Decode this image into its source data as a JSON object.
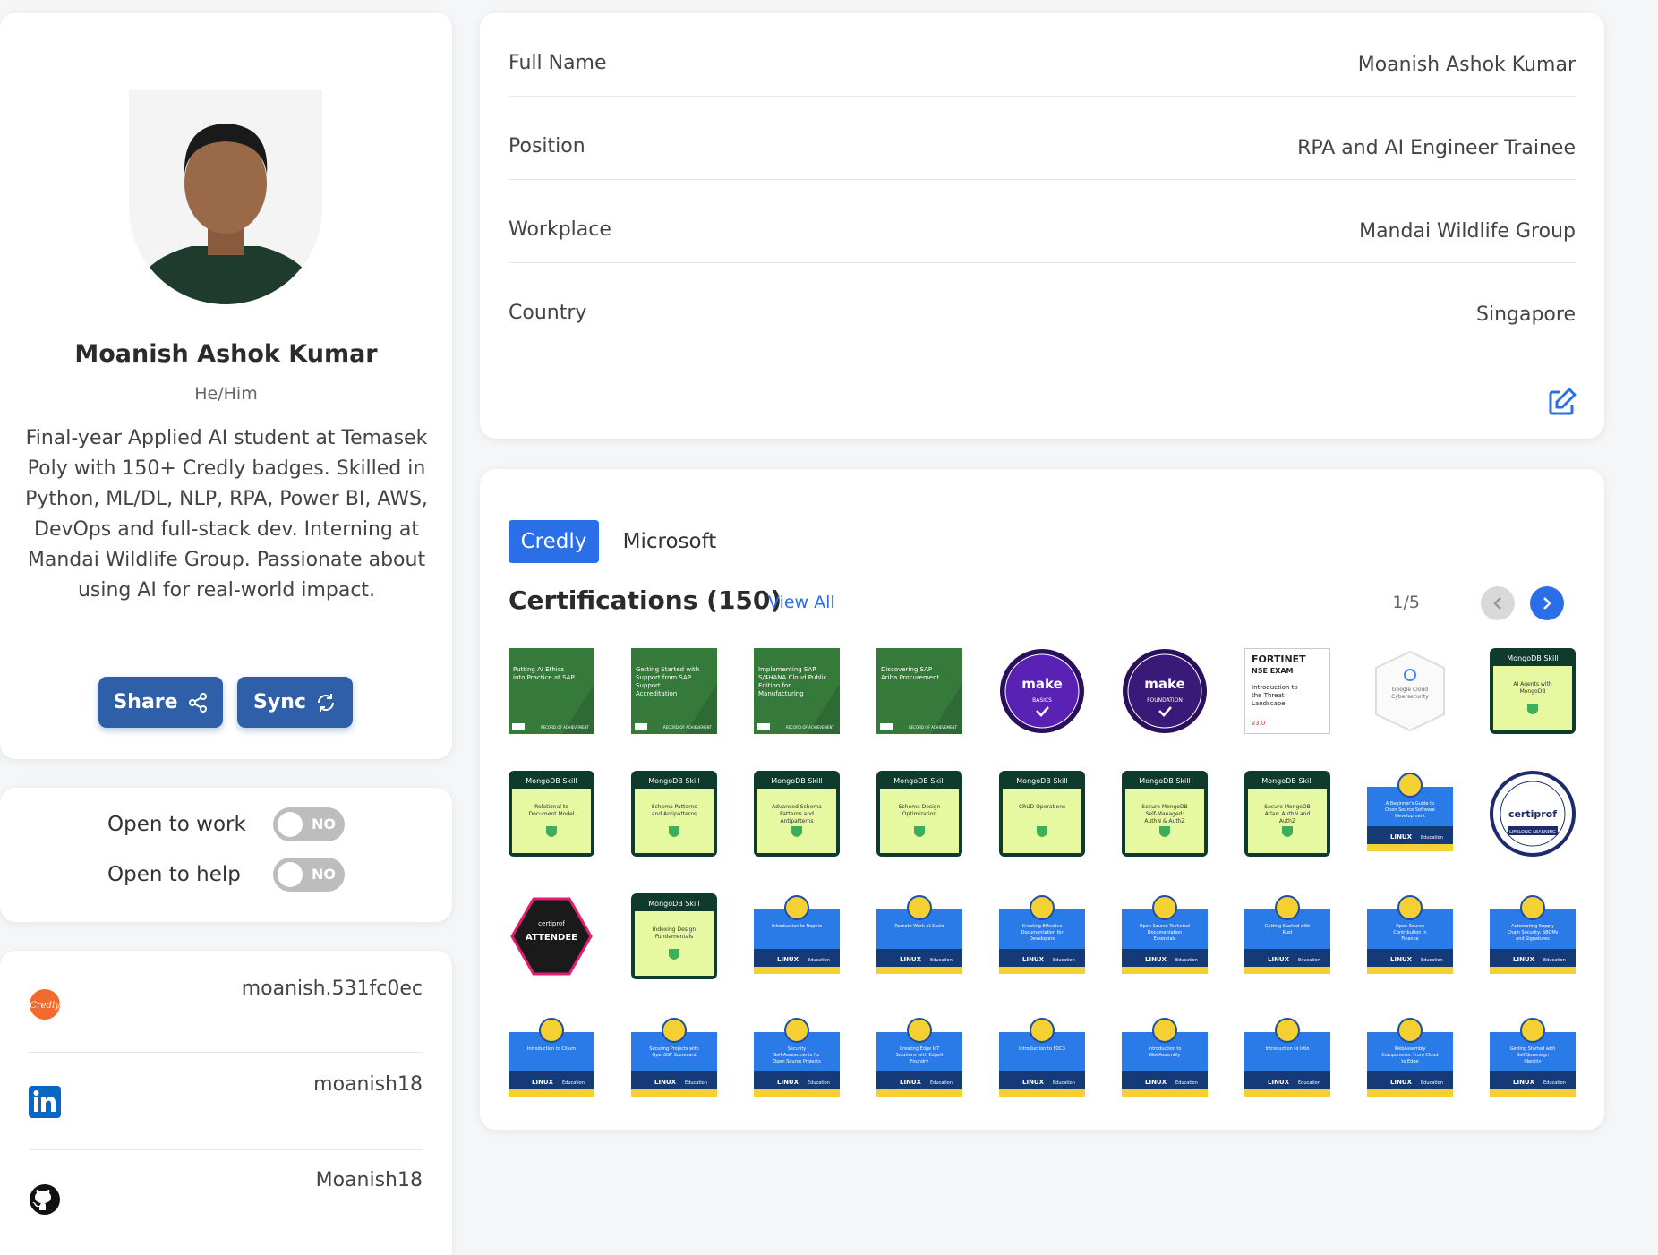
{
  "profile": {
    "name": "Moanish Ashok Kumar",
    "pronouns": "He/Him",
    "bio": "Final-year Applied AI student at Temasek Poly with 150+ Credly badges. Skilled in Python, ML/DL, NLP, RPA, Power BI, AWS, DevOps and full-stack dev. Interning at Mandai Wildlife Group. Passionate about using AI for real-world impact.",
    "share_label": "Share",
    "sync_label": "Sync"
  },
  "availability": {
    "open_to_work_label": "Open to work",
    "open_to_work_value": "NO",
    "open_to_help_label": "Open to help",
    "open_to_help_value": "NO"
  },
  "socials": [
    {
      "icon": "credly-icon",
      "handle": "moanish.531fc0ec"
    },
    {
      "icon": "linkedin-icon",
      "handle": "moanish18"
    },
    {
      "icon": "github-icon",
      "handle": "Moanish18"
    }
  ],
  "info": {
    "rows": [
      {
        "label": "Full Name",
        "value": "Moanish Ashok Kumar"
      },
      {
        "label": "Position",
        "value": "RPA and AI Engineer Trainee"
      },
      {
        "label": "Workplace",
        "value": "Mandai Wildlife Group"
      },
      {
        "label": "Country",
        "value": "Singapore"
      }
    ]
  },
  "certifications": {
    "tabs": [
      "Credly",
      "Microsoft"
    ],
    "active_tab": "Credly",
    "title": "Certifications (150)",
    "view_all": "View All",
    "pager": "1/5",
    "badges": [
      {
        "type": "sap",
        "text": "Putting AI Ethics into Practice at SAP"
      },
      {
        "type": "sap",
        "text": "Getting Started with Support from SAP Support Accreditation"
      },
      {
        "type": "sap",
        "text": "Implementing SAP S/4HANA Cloud Public Edition for Manufacturing"
      },
      {
        "type": "sap",
        "text": "Discovering SAP Ariba Procurement"
      },
      {
        "type": "make",
        "text": "BASICS"
      },
      {
        "type": "make",
        "text": "FOUNDATION"
      },
      {
        "type": "fortinet",
        "text": "Introduction to the Threat Landscape"
      },
      {
        "type": "google",
        "text": "Google Cloud Cybersecurity"
      },
      {
        "type": "mongodb",
        "text": "AI Agents with MongoDB"
      },
      {
        "type": "mongodb",
        "text": "Relational to Document Model"
      },
      {
        "type": "mongodb",
        "text": "Schema Patterns and Antipatterns"
      },
      {
        "type": "mongodb",
        "text": "Advanced Schema Patterns and Antipatterns"
      },
      {
        "type": "mongodb",
        "text": "Schema Design Optimization"
      },
      {
        "type": "mongodb",
        "text": "CRUD Operations"
      },
      {
        "type": "mongodb",
        "text": "Secure MongoDB Self-Managed: AuthN & AuthZ"
      },
      {
        "type": "mongodb",
        "text": "Secure MongoDB Atlas: AuthN and AuthZ"
      },
      {
        "type": "linux",
        "text": "A Beginner's Guide to Open Source Software Development"
      },
      {
        "type": "certiprof",
        "text": "LIFELONG LEARNING"
      },
      {
        "type": "hex",
        "text": "ATTENDEE"
      },
      {
        "type": "mongodb",
        "text": "Indexing Design Fundamentals"
      },
      {
        "type": "linux",
        "text": "Introduction to Nephio"
      },
      {
        "type": "linux",
        "text": "Remote Work at Scale"
      },
      {
        "type": "linux",
        "text": "Creating Effective Documentation for Developers"
      },
      {
        "type": "linux",
        "text": "Open Source Technical Documentation Essentials"
      },
      {
        "type": "linux",
        "text": "Getting Started with Rust"
      },
      {
        "type": "linux",
        "text": "Open Source Contribution in Finance"
      },
      {
        "type": "linux",
        "text": "Automating Supply Chain Security: SBOMs and Signatures"
      },
      {
        "type": "linux",
        "text": "Introduction to Cilium"
      },
      {
        "type": "linux",
        "text": "Securing Projects with OpenSSF Scorecard"
      },
      {
        "type": "linux",
        "text": "Security Self-Assessments for Open Source Projects"
      },
      {
        "type": "linux",
        "text": "Creating Edge IoT Solutions with EdgeX Foundry"
      },
      {
        "type": "linux",
        "text": "Introduction to FDC3"
      },
      {
        "type": "linux",
        "text": "Introduction to WebAssembly"
      },
      {
        "type": "linux",
        "text": "Introduction to Istio"
      },
      {
        "type": "linux",
        "text": "WebAssembly Components: From Cloud to Edge"
      },
      {
        "type": "linux",
        "text": "Getting Started with Self-Sovereign Identity"
      }
    ]
  },
  "colors": {
    "accent": "#2a6fe8",
    "button": "#2f5fa8",
    "toggle_off": "#bdbdbd"
  }
}
